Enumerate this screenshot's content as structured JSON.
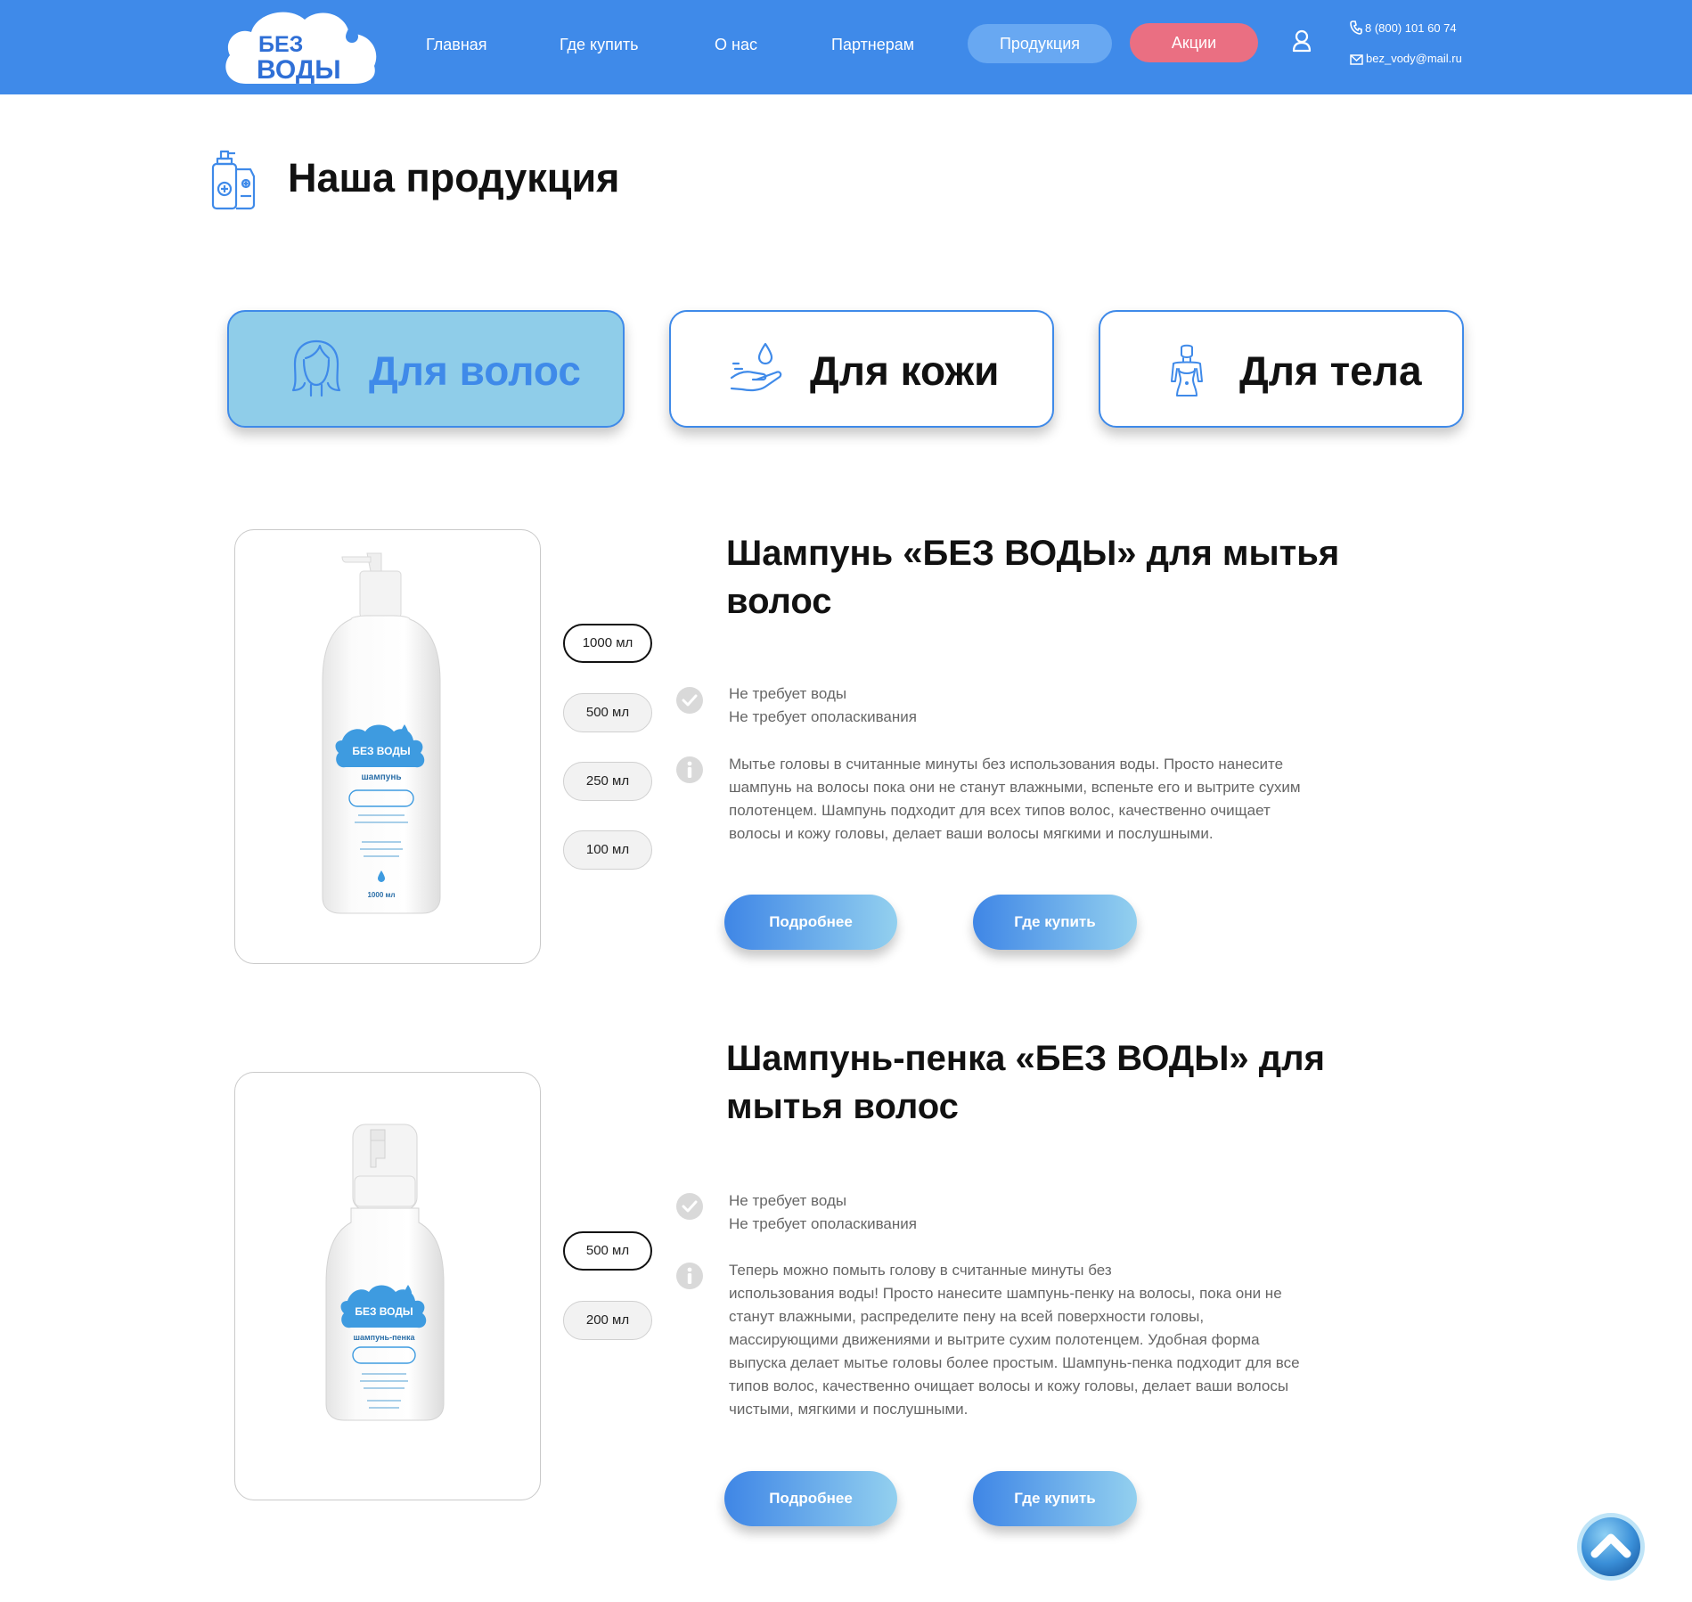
{
  "header": {
    "logo_line1": "БЕЗ",
    "logo_line2": "ВОДЫ",
    "nav": [
      "Главная",
      "Где купить",
      "О нас",
      "Партнерам"
    ],
    "products_label": "Продукция",
    "promo_label": "Акции",
    "phone": "8 (800) 101 60 74",
    "email": "bez_vody@mail.ru",
    "colors": {
      "bar": "#3f8ae9",
      "products_pill": "#68a8f2",
      "promo_pill": "#ea6f82"
    }
  },
  "page": {
    "title": "Наша продукция",
    "title_icon": "cosmetics-bottles-icon"
  },
  "categories": [
    {
      "label": "Для волос",
      "icon": "hair-head-icon",
      "active": true
    },
    {
      "label": "Для кожи",
      "icon": "hand-drop-icon",
      "active": false
    },
    {
      "label": "Для тела",
      "icon": "body-woman-icon",
      "active": false
    }
  ],
  "products": [
    {
      "title_line1": "Шампунь «БЕЗ ВОДЫ» для мытья",
      "title_line2": "волос",
      "sizes": [
        "1000 мл",
        "500 мл",
        "250 мл",
        "100 мл"
      ],
      "selected_size": "1000 мл",
      "feature_line1": "Не требует воды",
      "feature_line2": "Не требует ополаскивания",
      "description": [
        "Мытье головы в считанные минуты без использования воды. Просто нанесите",
        "шампунь на волосы пока они не станут влажными, вспеньте его и вытрите сухим",
        "полотенцем. Шампунь подходит для всех типов волос, качественно очищает",
        "волосы и кожу головы, делает ваши волосы мягкими и послушными."
      ],
      "bottle_brand": "БЕЗ ВОДЫ",
      "bottle_type": "шампунь",
      "bottle_volume": "1000 мл",
      "more_label": "Подробнее",
      "buy_label": "Где купить"
    },
    {
      "title_line1": "Шампунь-пенка «БЕЗ ВОДЫ» для",
      "title_line2": "мытья волос",
      "sizes": [
        "500 мл",
        "200 мл"
      ],
      "selected_size": "500 мл",
      "feature_line1": "Не требует воды",
      "feature_line2": "Не требует ополаскивания",
      "description": [
        "Теперь можно помыть голову в считанные минуты без",
        "использования воды! Просто нанесите шампунь-пенку на волосы, пока они не",
        "станут влажными, распределите пену на всей поверхности головы,",
        "массирующими движениями  и вытрите сухим полотенцем. Удобная форма",
        "выпуска делает мытье головы более простым. Шампунь-пенка подходит для все",
        "типов волос, качественно очищает волосы и кожу головы, делает ваши волосы",
        "чистыми, мягкими и послушными."
      ],
      "bottle_brand": "БЕЗ ВОДЫ",
      "bottle_type": "шампунь-пенка",
      "more_label": "Подробнее",
      "buy_label": "Где купить"
    }
  ]
}
